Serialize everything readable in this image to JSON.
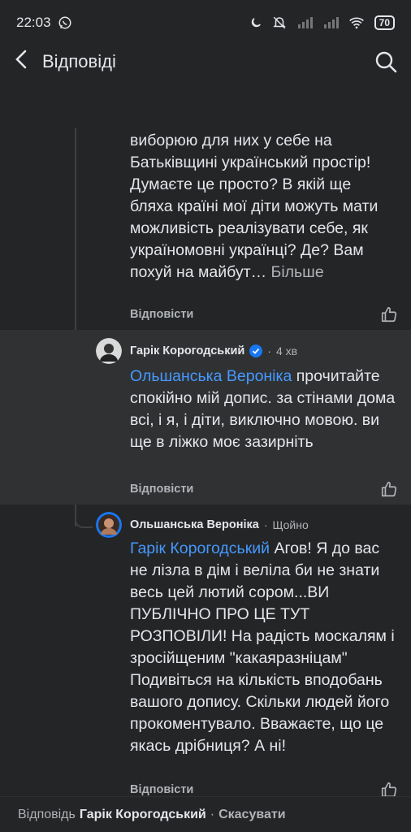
{
  "status": {
    "time": "22:03",
    "battery": "70",
    "whatsapp_icon": "whatsapp-icon"
  },
  "header": {
    "title": "Відповіді",
    "back_icon": "back-arrow-icon",
    "search_icon": "search-icon"
  },
  "comments": [
    {
      "text": "виборюю для них у себе на Батьківщині український простір! Думаєте це просто? В якій ще бляха країні мої діти можуть мати можливість реалізувати себе, як україномовні українці? Де? Вам похуй на майбут…",
      "more": "Більше",
      "reply": "Відповісти"
    },
    {
      "author": "Гарік Корогодський",
      "time": "4 хв",
      "mention": "Ольшанська Вероніка",
      "text": " прочитайте спокійно мій допис. за стінами дома всі, і я, і діти, виключно мовою. ви ще в ліжко моє зазирніть",
      "reply": "Відповісти"
    },
    {
      "author": "Ольшанська Вероніка",
      "time": "Щойно",
      "mention": "Гарік Корогодський",
      "text": " Агов! Я до вас не лізла в дім і веліла би не знати весь цей лютий сором...ВИ ПУБЛІЧНО ПРО ЦЕ ТУТ РОЗПОВІЛИ! На радість москалям і зросійщеним \"какаяразніцам\"  Подивіться на кількість вподобань вашого допису. Скільки людей його прокоментувало. Вважаєте, що це якась дрібниця? А ні!",
      "reply": "Відповісти"
    }
  ],
  "bottom": {
    "prefix": "Відповідь",
    "name": "Гарік Корогодський",
    "separator": "·",
    "cancel": "Скасувати"
  },
  "colors": {
    "background": "#242526",
    "highlight": "#303133",
    "mention": "#4599ff",
    "verified": "#1877f2"
  }
}
